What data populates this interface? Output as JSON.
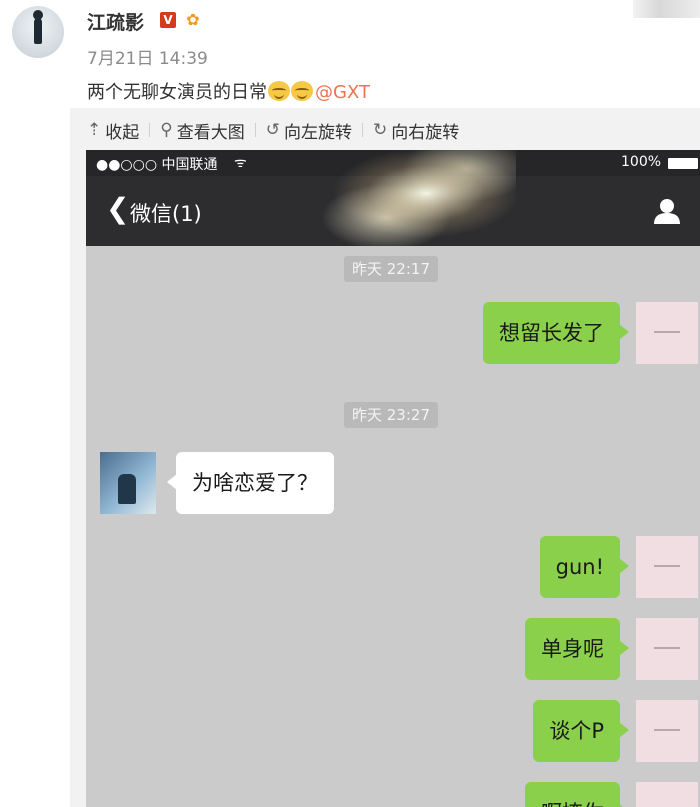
{
  "post": {
    "username": "江疏影",
    "verified_badge": "V",
    "timestamp": "7月21日 14:39",
    "text": "两个无聊女演员的日常",
    "mention": "@GXT"
  },
  "toolbar": {
    "collapse_label": "收起",
    "view_large_label": "查看大图",
    "rotate_left_label": "向左旋转",
    "rotate_right_label": "向右旋转"
  },
  "phone": {
    "carrier": "●●○○○ 中国联通",
    "battery": "100%",
    "back_label": "微信(1)",
    "messages": [
      {
        "type": "time",
        "text": "昨天 22:17"
      },
      {
        "type": "out",
        "text": "想留长发了"
      },
      {
        "type": "time",
        "text": "昨天 23:27"
      },
      {
        "type": "in",
        "text": "为啥恋爱了？"
      },
      {
        "type": "out",
        "text": "gun!"
      },
      {
        "type": "out",
        "text": "单身呢"
      },
      {
        "type": "out",
        "text": "谈个P"
      },
      {
        "type": "out",
        "text": "啊撩你"
      }
    ]
  },
  "colors": {
    "accent_mention": "#eb7350",
    "bubble_out": "#8ad04a",
    "chat_bg": "#cbcbcb",
    "navbar_bg": "#2d2d2f"
  },
  "icons": [
    "collapse-icon",
    "search-icon",
    "rotate-left-icon",
    "rotate-right-icon",
    "wifi-icon",
    "battery-icon",
    "back-icon",
    "profile-icon",
    "emoji-icon"
  ]
}
